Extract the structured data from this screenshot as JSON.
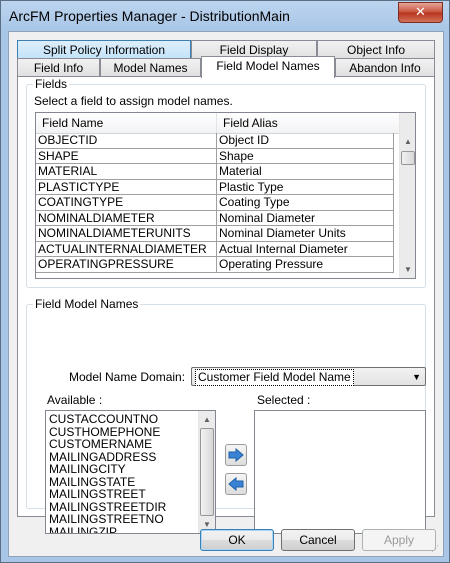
{
  "window": {
    "title": "ArcFM Properties Manager - DistributionMain",
    "close_glyph": "✕"
  },
  "tabs": {
    "row1": [
      {
        "label": "Split Policy Information"
      },
      {
        "label": "Field Display"
      },
      {
        "label": "Object Info"
      }
    ],
    "row2": [
      {
        "label": "Field Info"
      },
      {
        "label": "Model Names"
      },
      {
        "label": "Field Model Names"
      },
      {
        "label": "Abandon Info"
      }
    ],
    "selected": "Field Model Names"
  },
  "fields_group": {
    "label": "Fields",
    "instruction": "Select a field to assign model names.",
    "columns": [
      "Field Name",
      "Field Alias"
    ],
    "rows": [
      [
        "OBJECTID",
        "Object ID"
      ],
      [
        "SHAPE",
        "Shape"
      ],
      [
        "MATERIAL",
        "Material"
      ],
      [
        "PLASTICTYPE",
        "Plastic Type"
      ],
      [
        "COATINGTYPE",
        "Coating Type"
      ],
      [
        "NOMINALDIAMETER",
        "Nominal Diameter"
      ],
      [
        "NOMINALDIAMETERUNITS",
        "Nominal Diameter Units"
      ],
      [
        "ACTUALINTERNALDIAMETER",
        "Actual Internal Diameter"
      ],
      [
        "OPERATINGPRESSURE",
        "Operating Pressure"
      ]
    ]
  },
  "model_group": {
    "label": "Field Model Names",
    "domain_label": "Model Name Domain:",
    "domain_value": "Customer Field Model Name",
    "available_label": "Available :",
    "selected_label": "Selected :",
    "available_items": [
      "CUSTACCOUNTNO",
      "CUSTHOMEPHONE",
      "CUSTOMERNAME",
      "MAILINGADDRESS",
      "MAILINGCITY",
      "MAILINGSTATE",
      "MAILINGSTREET",
      "MAILINGSTREETDIR",
      "MAILINGSTREETNO",
      "MAILINGZIP"
    ],
    "selected_items": []
  },
  "buttons": {
    "ok": "OK",
    "cancel": "Cancel",
    "apply": "Apply"
  },
  "colors": {
    "accent_blue": "#3c7fb1",
    "arrow_blue": "#3a83d4"
  }
}
